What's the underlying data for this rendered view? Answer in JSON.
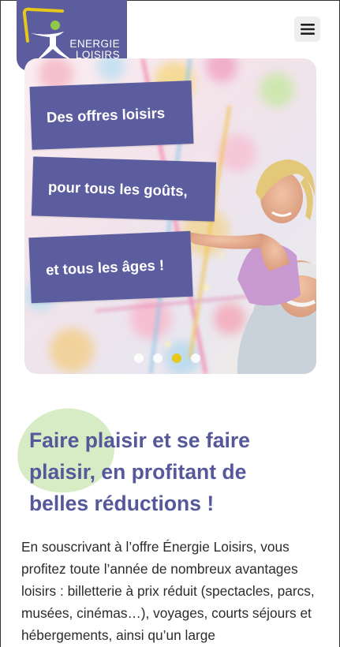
{
  "brand": {
    "logo_line1": "ENERGIE",
    "logo_line2": "LOISIRS",
    "logo_color": "#5b5d9f",
    "accent_yellow": "#e8c71c",
    "accent_green": "#8fc74a"
  },
  "header": {
    "menu_icon": "hamburger-menu-icon"
  },
  "hero": {
    "labels": [
      "Des offres loisirs",
      "pour tous les goûts,",
      "et tous les âges !"
    ],
    "slides_count": 4,
    "active_slide": 3
  },
  "main": {
    "heading": "Faire plaisir et se faire plaisir, en profitant de belles réductions !",
    "intro": "En souscrivant à l’offre Énergie Loisirs, vous profitez toute l’année de nombreux avantages loisirs : billetterie à prix réduit (spectacles, parcs, musées, cinémas…), voyages, courts séjours et hébergements, ainsi qu’un large"
  }
}
